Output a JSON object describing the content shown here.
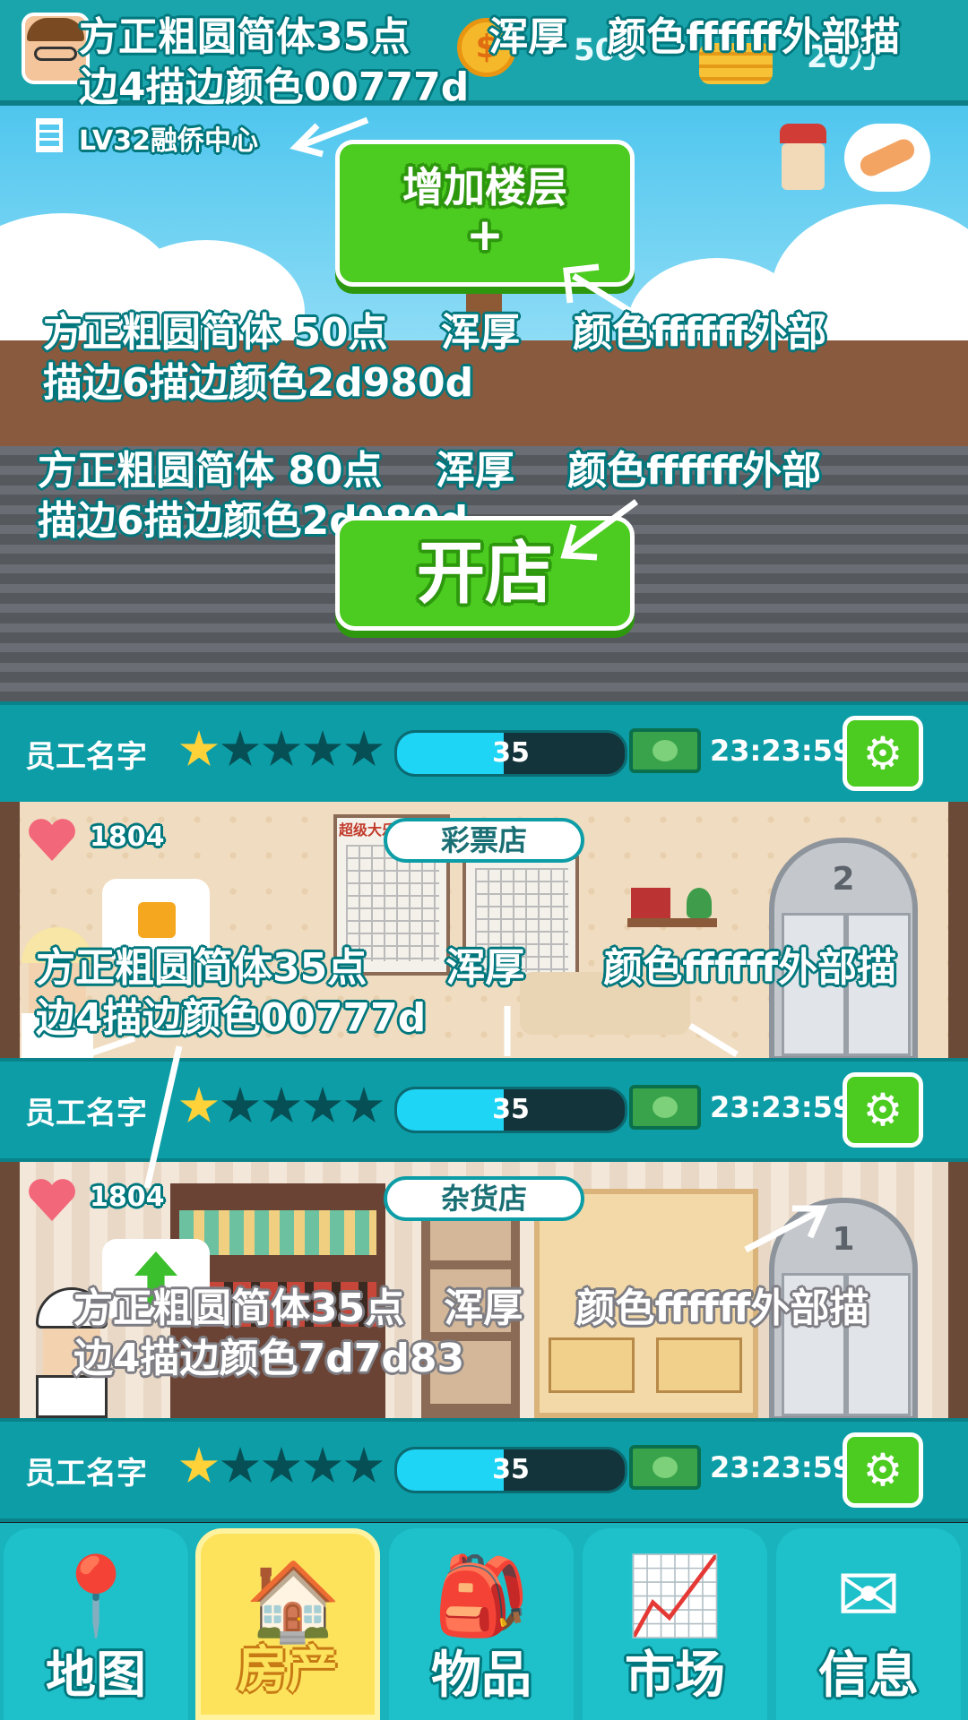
{
  "topbar": {
    "coin_value_1": "500",
    "coin_value_2": "20万",
    "building_label": "LV32融侨中心"
  },
  "add_floor": {
    "line1": "增加楼层",
    "line2": "+"
  },
  "open_shop": {
    "label": "开店"
  },
  "staff_rows": [
    {
      "name": "员工名字",
      "stars_filled": 1,
      "stars_total": 5,
      "progress_value": "35",
      "progress_fraction": 0.47,
      "timer": "23:23:59"
    },
    {
      "name": "员工名字",
      "stars_filled": 1,
      "stars_total": 5,
      "progress_value": "35",
      "progress_fraction": 0.47,
      "timer": "23:23:59"
    },
    {
      "name": "员工名字",
      "stars_filled": 1,
      "stars_total": 5,
      "progress_value": "35",
      "progress_fraction": 0.47,
      "timer": "23:23:59"
    }
  ],
  "rooms": [
    {
      "shop_name": "彩票店",
      "likes": "1804",
      "floor_number": "2",
      "poster": "超级大乐透"
    },
    {
      "shop_name": "杂货店",
      "likes": "1804",
      "floor_number": "1"
    }
  ],
  "annotations": {
    "top": {
      "line1": "方正粗圆简体35点　　浑厚　颜色ffffff外部描",
      "line2": "边4描边颜色00777d"
    },
    "add_floor": {
      "line1": "方正粗圆简体 50点　 浑厚　 颜色ffffff外部",
      "line2": "描边6描边颜色2d980d"
    },
    "open_shop": {
      "line1": "方正粗圆简体 80点　 浑厚　 颜色ffffff外部",
      "line2": "描边6描边颜色2d980d"
    },
    "staff": {
      "line1": "方正粗圆简体35点　　浑厚　　颜色ffffff外部描",
      "line2": "边4描边颜色00777d"
    },
    "grey": {
      "line1": "方正粗圆简体35点　浑厚　 颜色ffffff外部描",
      "line2": "边4描边颜色7d7d83"
    }
  },
  "nav": [
    {
      "label": "地图",
      "icon": "map-pin-icon",
      "glyph": "📍",
      "active": false
    },
    {
      "label": "房产",
      "icon": "house-icon",
      "glyph": "🏠",
      "active": true
    },
    {
      "label": "物品",
      "icon": "backpack-icon",
      "glyph": "🎒",
      "active": false
    },
    {
      "label": "市场",
      "icon": "coins-chart-icon",
      "glyph": "📈",
      "active": false
    },
    {
      "label": "信息",
      "icon": "mail-icon",
      "glyph": "✉",
      "active": false
    }
  ],
  "colors": {
    "teal_outline": "#00777d",
    "green_outline": "#2d980d",
    "grey_outline": "#7d7d83",
    "button_green": "#4ccb21"
  }
}
